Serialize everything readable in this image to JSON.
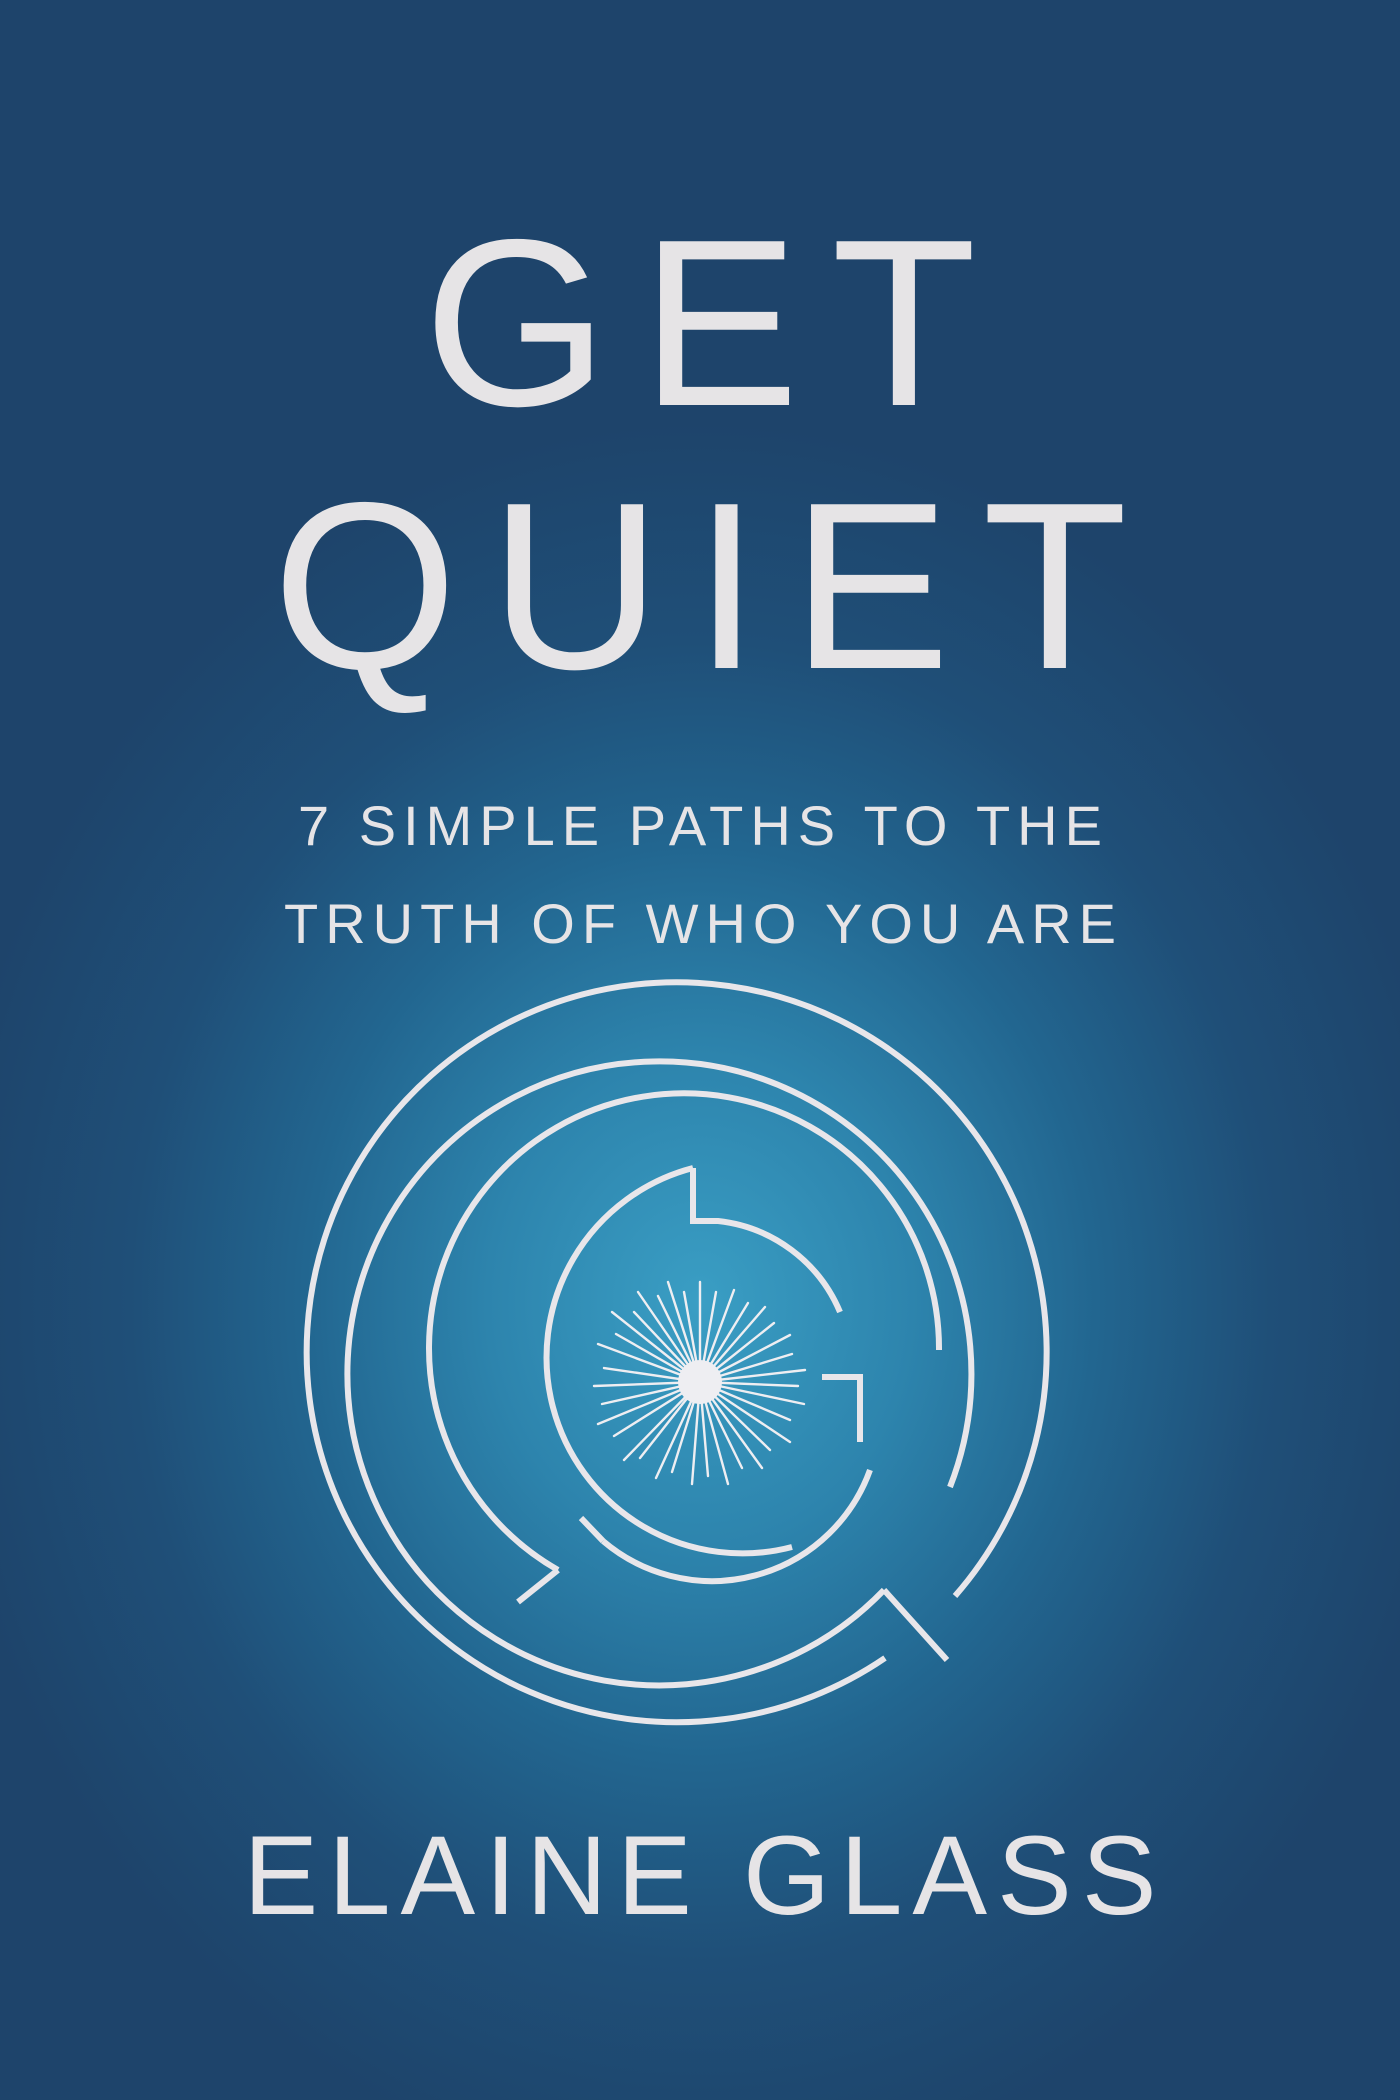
{
  "cover": {
    "title_line_1": "GET",
    "title_line_2": "QUIET",
    "subtitle_line_1": "7 SIMPLE PATHS TO THE",
    "subtitle_line_2": "TRUTH OF WHO YOU ARE",
    "author": "ELAINE GLASS",
    "emblem_icon": "labyrinth-g-icon",
    "colors": {
      "background_outer": "#1e446b",
      "background_glow": "#3a9ec4",
      "text": "#e6e4e6"
    }
  }
}
